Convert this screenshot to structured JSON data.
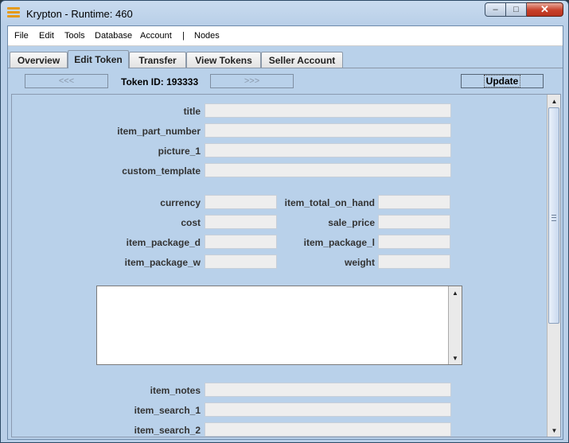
{
  "window": {
    "title": "Krypton - Runtime: 460",
    "icon": "app-menu-icon",
    "controls": {
      "minimize": "–",
      "maximize": "□",
      "close": "✕"
    }
  },
  "menubar": {
    "items": [
      "File",
      "Edit",
      "Tools",
      "Database",
      "Account",
      "|",
      "Nodes"
    ]
  },
  "tabs": [
    {
      "label": "Overview",
      "active": false
    },
    {
      "label": "Edit Token",
      "active": true
    },
    {
      "label": "Transfer",
      "active": false
    },
    {
      "label": "View Tokens",
      "active": false
    },
    {
      "label": "Seller Account",
      "active": false
    }
  ],
  "toolbar": {
    "prev_label": "<<<",
    "token_id_text": "Token ID: 193333",
    "next_label": ">>>",
    "update_label": "Update"
  },
  "form": {
    "fields": {
      "title": {
        "label": "title",
        "value": ""
      },
      "item_part_number": {
        "label": "item_part_number",
        "value": ""
      },
      "picture_1": {
        "label": "picture_1",
        "value": ""
      },
      "custom_template": {
        "label": "custom_template",
        "value": ""
      },
      "currency": {
        "label": "currency",
        "value": ""
      },
      "item_total_on_hand": {
        "label": "item_total_on_hand",
        "value": ""
      },
      "cost": {
        "label": "cost",
        "value": ""
      },
      "sale_price": {
        "label": "sale_price",
        "value": ""
      },
      "item_package_d": {
        "label": "item_package_d",
        "value": ""
      },
      "item_package_l": {
        "label": "item_package_l",
        "value": ""
      },
      "item_package_w": {
        "label": "item_package_w",
        "value": ""
      },
      "weight": {
        "label": "weight",
        "value": ""
      },
      "item_notes": {
        "label": "item_notes",
        "value": ""
      },
      "item_search_1": {
        "label": "item_search_1",
        "value": ""
      },
      "item_search_2": {
        "label": "item_search_2",
        "value": ""
      }
    },
    "description_text": ""
  },
  "scroll_arrows": {
    "up": "▲",
    "down": "▼"
  },
  "colors": {
    "panel_bg": "#b9d1ea",
    "field_bg": "#eeeeee",
    "close_button": "#c8402a",
    "app_icon": "#e59a18"
  }
}
